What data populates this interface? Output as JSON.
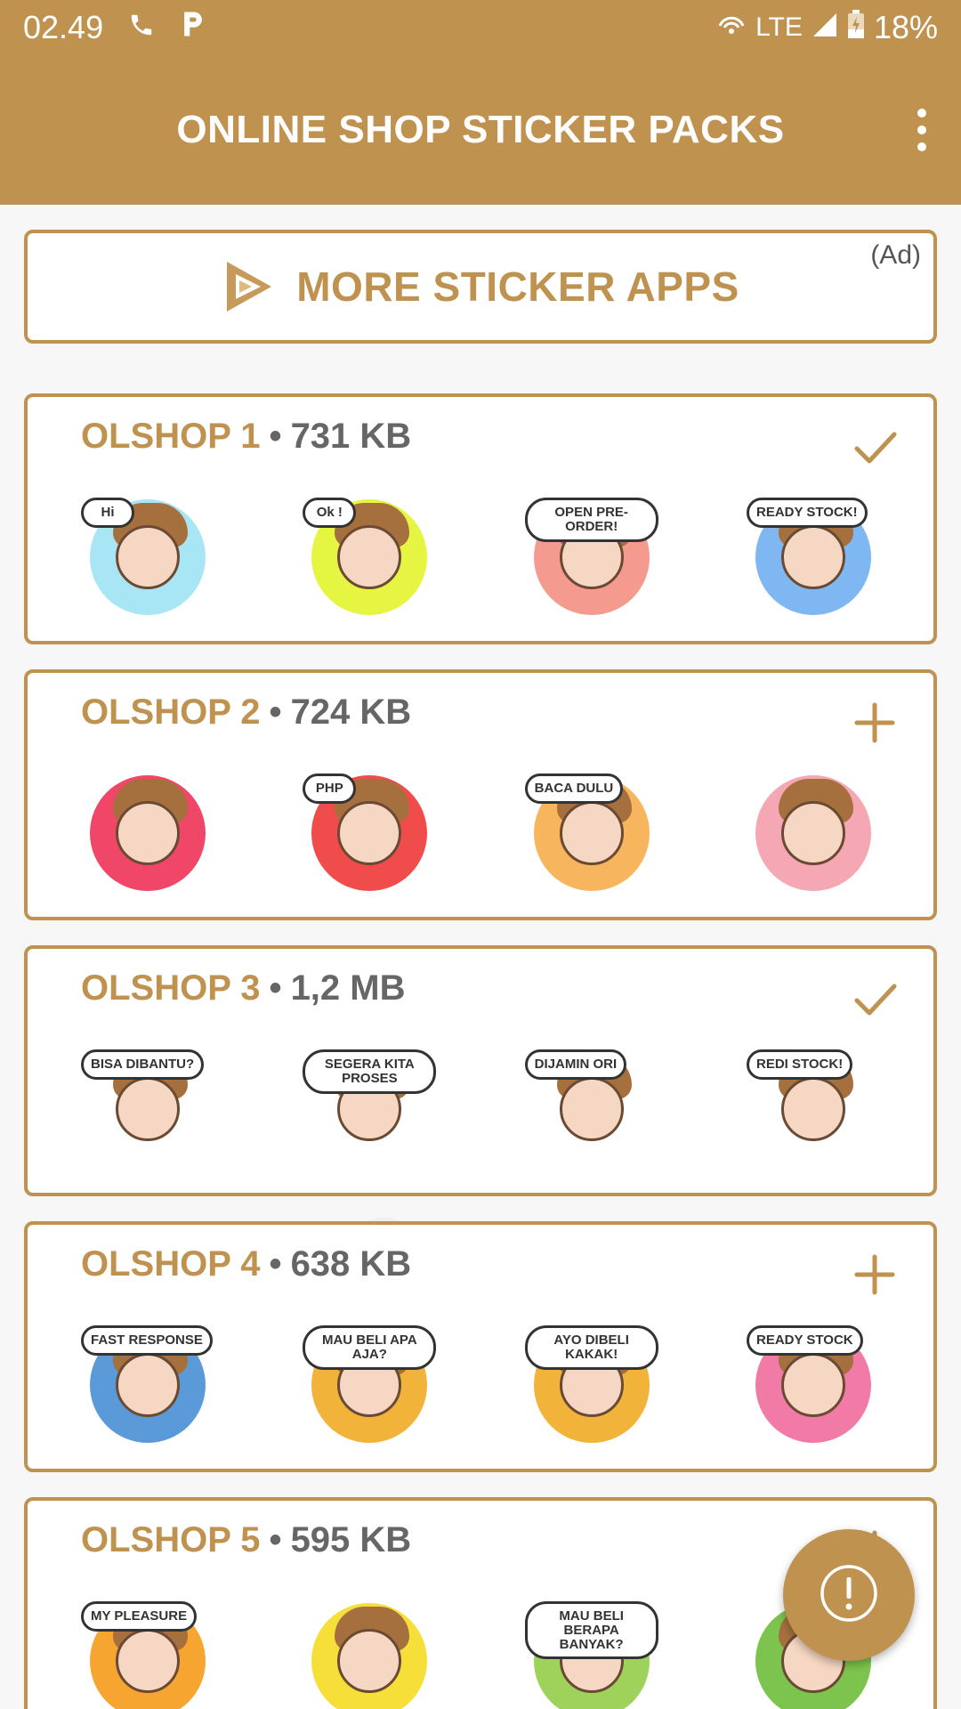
{
  "status_bar": {
    "time": "02.49",
    "network": "LTE",
    "battery": "18%"
  },
  "app_bar": {
    "title": "ONLINE SHOP STICKER PACKS"
  },
  "more_apps": {
    "label": "MORE STICKER APPS",
    "ad": "(Ad)"
  },
  "packs": [
    {
      "name": "OLSHOP 1",
      "sep": "•",
      "size": "731 KB",
      "action": "check",
      "stickers": [
        {
          "text": "Hi",
          "color": "#a8e6f5"
        },
        {
          "text": "Ok !",
          "color": "#e6f542"
        },
        {
          "text": "OPEN PRE-ORDER!",
          "color": "#f59a8f"
        },
        {
          "text": "READY STOCK!",
          "color": "#7fb7f2"
        }
      ]
    },
    {
      "name": "OLSHOP 2",
      "sep": "•",
      "size": "724 KB",
      "action": "add",
      "stickers": [
        {
          "text": "",
          "color": "#f04768"
        },
        {
          "text": "PHP",
          "color": "#f04c4c"
        },
        {
          "text": "BACA DULU",
          "color": "#f7b55d"
        },
        {
          "text": "",
          "color": "#f5a7b3"
        }
      ]
    },
    {
      "name": "OLSHOP 3",
      "sep": "•",
      "size": "1,2 MB",
      "action": "check",
      "stickers": [
        {
          "text": "BISA DIBANTU?",
          "color": "#ffffff"
        },
        {
          "text": "SEGERA KITA PROSES",
          "color": "#ffffff"
        },
        {
          "text": "DIJAMIN ORI",
          "color": "#ffffff"
        },
        {
          "text": "REDI STOCK!",
          "color": "#ffffff"
        }
      ]
    },
    {
      "name": "OLSHOP 4",
      "sep": "•",
      "size": "638 KB",
      "action": "add",
      "stickers": [
        {
          "text": "FAST RESPONSE",
          "color": "#5b9ad9"
        },
        {
          "text": "MAU BELI APA AJA?",
          "color": "#f2b33a"
        },
        {
          "text": "AYO DIBELI KAKAK!",
          "color": "#f2b33a"
        },
        {
          "text": "READY STOCK",
          "color": "#f27aa7"
        }
      ]
    },
    {
      "name": "OLSHOP 5",
      "sep": "•",
      "size": "595 KB",
      "action": "add",
      "stickers": [
        {
          "text": "MY PLEASURE",
          "color": "#f7a531"
        },
        {
          "text": "",
          "color": "#f7df3a"
        },
        {
          "text": "MAU BELI BERAPA BANYAK?",
          "color": "#9fd25a"
        },
        {
          "text": "",
          "color": "#7cc44d"
        }
      ]
    }
  ],
  "colors": {
    "brand": "#bf924f",
    "text_muted": "#666666"
  }
}
